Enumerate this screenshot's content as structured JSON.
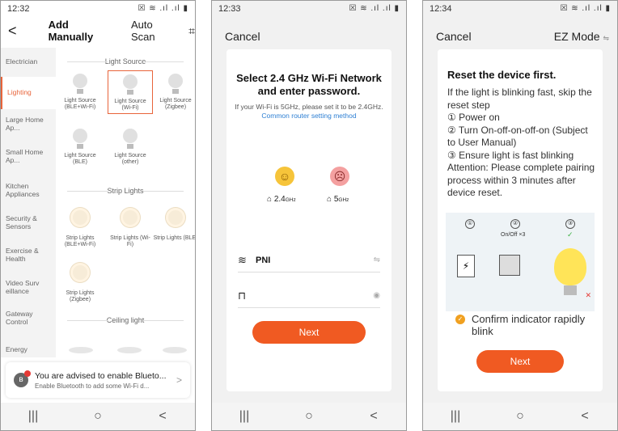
{
  "colors": {
    "accent": "#f05a22",
    "link": "#2d7fd3",
    "sidebar_bg": "#f3f3f3"
  },
  "phone1": {
    "status": {
      "time": "12:32",
      "icons": "☒ ≋ .ıl .ıl ▮"
    },
    "header": {
      "back": "<",
      "tab_manual": "Add Manually",
      "tab_auto": "Auto Scan",
      "scan_icon": "⌗"
    },
    "sidebar": [
      "Electrician",
      "Lighting",
      "Large Home Ap...",
      "Small Home Ap...",
      "Kitchen Appliances",
      "Security & Sensors",
      "Exercise & Health",
      "Video Surv eillance",
      "Gateway Control",
      "Energy"
    ],
    "sections": {
      "light_source": "Light Source",
      "strip_lights": "Strip Lights",
      "ceiling_light": "Ceiling light"
    },
    "devices": {
      "ls_ble_wifi": "Light Source (BLE+Wi-Fi)",
      "ls_wifi": "Light Source (Wi-Fi)",
      "ls_zigbee": "Light Source (Zigbee)",
      "ls_ble": "Light Source (BLE)",
      "ls_other": "Light Source (other)",
      "st_ble_wifi": "Strip Lights (BLE+Wi-Fi)",
      "st_wifi": "Strip Lights (Wi-Fi)",
      "st_ble": "Strip Lights (BLE)",
      "st_zigbee": "Strip Lights (Zigbee)"
    },
    "banner": {
      "title": "You are advised to enable Blueto...",
      "subtitle": "Enable Bluetooth to add some Wi-Fi d...",
      "arrow": ">"
    },
    "nav": {
      "recent": "|||",
      "home": "○",
      "back": "<"
    }
  },
  "phone2": {
    "status": {
      "time": "12:33",
      "icons": "☒ ≋ .ıl .ıl ▮"
    },
    "cancel": "Cancel",
    "title": "Select 2.4 GHz Wi-Fi Network and enter password.",
    "desc": "If your Wi-Fi is 5GHz, please set it to be 2.4GHz.",
    "link": "Common router setting method",
    "band_ok": "2.4",
    "band_ok_unit": "GHz",
    "band_bad": "5",
    "band_bad_unit": "GHz",
    "ssid": "PNI",
    "next": "Next",
    "nav": {
      "recent": "|||",
      "home": "○",
      "back": "<"
    }
  },
  "phone3": {
    "status": {
      "time": "12:34",
      "icons": "☒ ≋ .ıl .ıl ▮"
    },
    "cancel": "Cancel",
    "ez_mode": "EZ Mode",
    "title": "Reset the device first.",
    "line1": "If the light is blinking fast, skip the reset step",
    "line2": "① Power on",
    "line3": "② Turn On-off-on-off-on (Subject to User Manual)",
    "line4": "③ Ensure light is fast blinking",
    "line5": "Attention: Please complete pairing process within 3 minutes after device reset.",
    "illus": {
      "step1": "①",
      "step2": "②",
      "step3": "③",
      "onoff": "On/Off ×3"
    },
    "confirm": "Confirm indicator rapidly blink",
    "next": "Next",
    "nav": {
      "recent": "|||",
      "home": "○",
      "back": "<"
    }
  }
}
